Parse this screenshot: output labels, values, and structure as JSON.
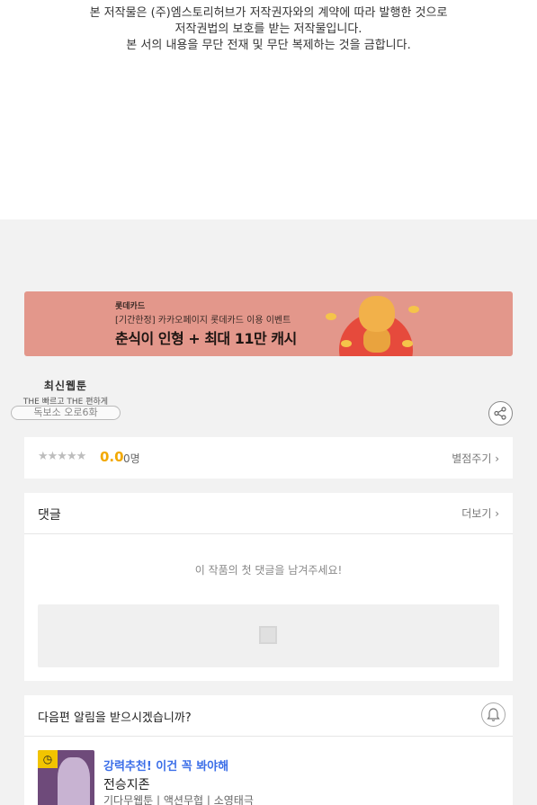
{
  "copyright": {
    "line1": "본 저작물은 (주)엠스토리허브가 저작권자와의 계약에 따라 발행한 것으로",
    "line2": "저작권법의 보호를 받는 저작물입니다.",
    "line3": "본 서의 내용을 무단 전재 및 무단 복제하는 것을 금합니다."
  },
  "banner": {
    "brand": "롯데카드",
    "subtitle": "[기간한정] 카카오페이지 롯데카드 이용 이벤트",
    "title": "춘식이 인형 + 최대 11만 캐시",
    "colors": {
      "background": "#e3978b",
      "circle": "#e64a3c"
    }
  },
  "logo": {
    "main": "최신웹툰",
    "tagline": "THE 빠르고 THE 편하게",
    "pill_text": "독보소 오로6화"
  },
  "rating": {
    "stars": "★★★★★",
    "score": "0.0",
    "count": "0명",
    "rate_link": "별점주기 ›"
  },
  "comments": {
    "title": "댓글",
    "more": "더보기 ›",
    "empty_message": "이 작품의 첫 댓글을 남겨주세요!"
  },
  "notify": {
    "title": "다음편 알림을 받으시겠습니까?",
    "bell_icon": "bell-icon",
    "recommendation": {
      "label": "강력추천! 이건 꼭 봐야해",
      "name": "전승지존",
      "tags": "기다무웹툰 | 액션무협 | 소영태극",
      "badge_icon": "clock-icon"
    }
  },
  "colors": {
    "accent_blue": "#3b6ee8",
    "score_yellow": "#f2a900"
  }
}
